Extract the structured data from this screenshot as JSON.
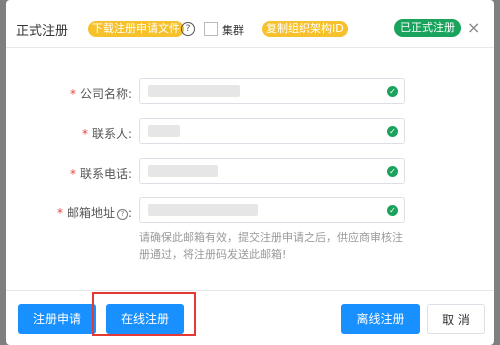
{
  "dialog": {
    "title": "正式注册",
    "download_link": "下载注册申请文件",
    "help_glyph": "?",
    "checkbox_label": "集群",
    "copy_link": "复制组织架构ID",
    "status_badge": "已正式注册",
    "close_glyph": "×"
  },
  "form": {
    "required_mark": "*",
    "fields": [
      {
        "label": "公司名称:"
      },
      {
        "label": "联系人:"
      },
      {
        "label": "联系电话:"
      },
      {
        "label": "邮箱地址",
        "suffix": ":"
      }
    ],
    "hint": "请确保此邮箱有效，提交注册申请之后，供应商审核注册通过，将注册码发送此邮箱!"
  },
  "footer": {
    "register_apply": "注册申请",
    "online_register": "在线注册",
    "offline_register": "离线注册",
    "cancel": "取 消"
  },
  "colors": {
    "accent": "#1890ff",
    "success": "#1aa35c",
    "warning_pill": "#f6c12b",
    "highlight_box": "#e53935"
  }
}
